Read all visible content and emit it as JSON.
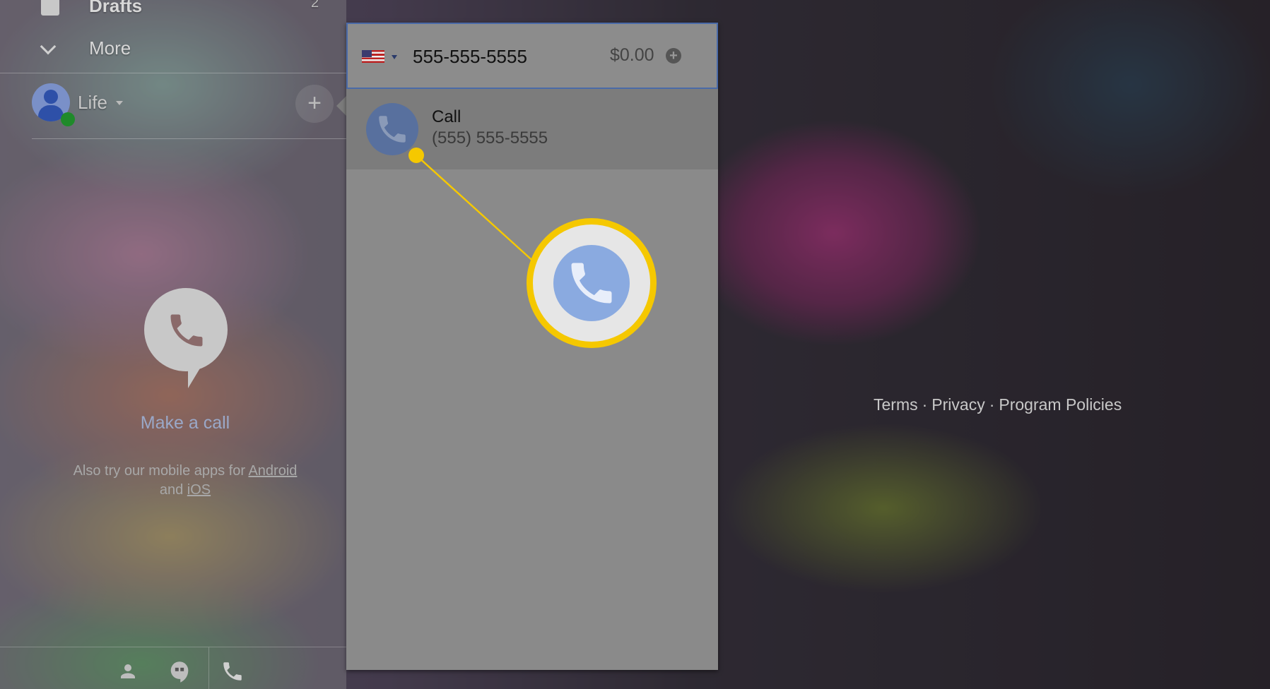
{
  "sidebar": {
    "drafts_label": "Drafts",
    "drafts_count": "2",
    "more_label": "More",
    "account_name": "Life"
  },
  "empty_state": {
    "title": "Make a call",
    "subtitle_prefix": "Also try our mobile apps for",
    "android_link": "Android",
    "and_text": "and",
    "ios_link": "iOS"
  },
  "dialer": {
    "country": "US",
    "number_value": "555-555-5555",
    "credit": "$0.00",
    "suggestion_label": "Call",
    "suggestion_number": "(555) 555-5555"
  },
  "footer": {
    "terms": "Terms",
    "privacy": "Privacy",
    "policies": "Program Policies",
    "separator": "·"
  },
  "colors": {
    "highlight": "#f5c800",
    "call_blue": "#8aaae0",
    "status_online": "#1f8a2a"
  },
  "bottom_tabs": [
    {
      "icon": "person-icon"
    },
    {
      "icon": "hangouts-quote-icon"
    },
    {
      "icon": "phone-icon"
    }
  ]
}
